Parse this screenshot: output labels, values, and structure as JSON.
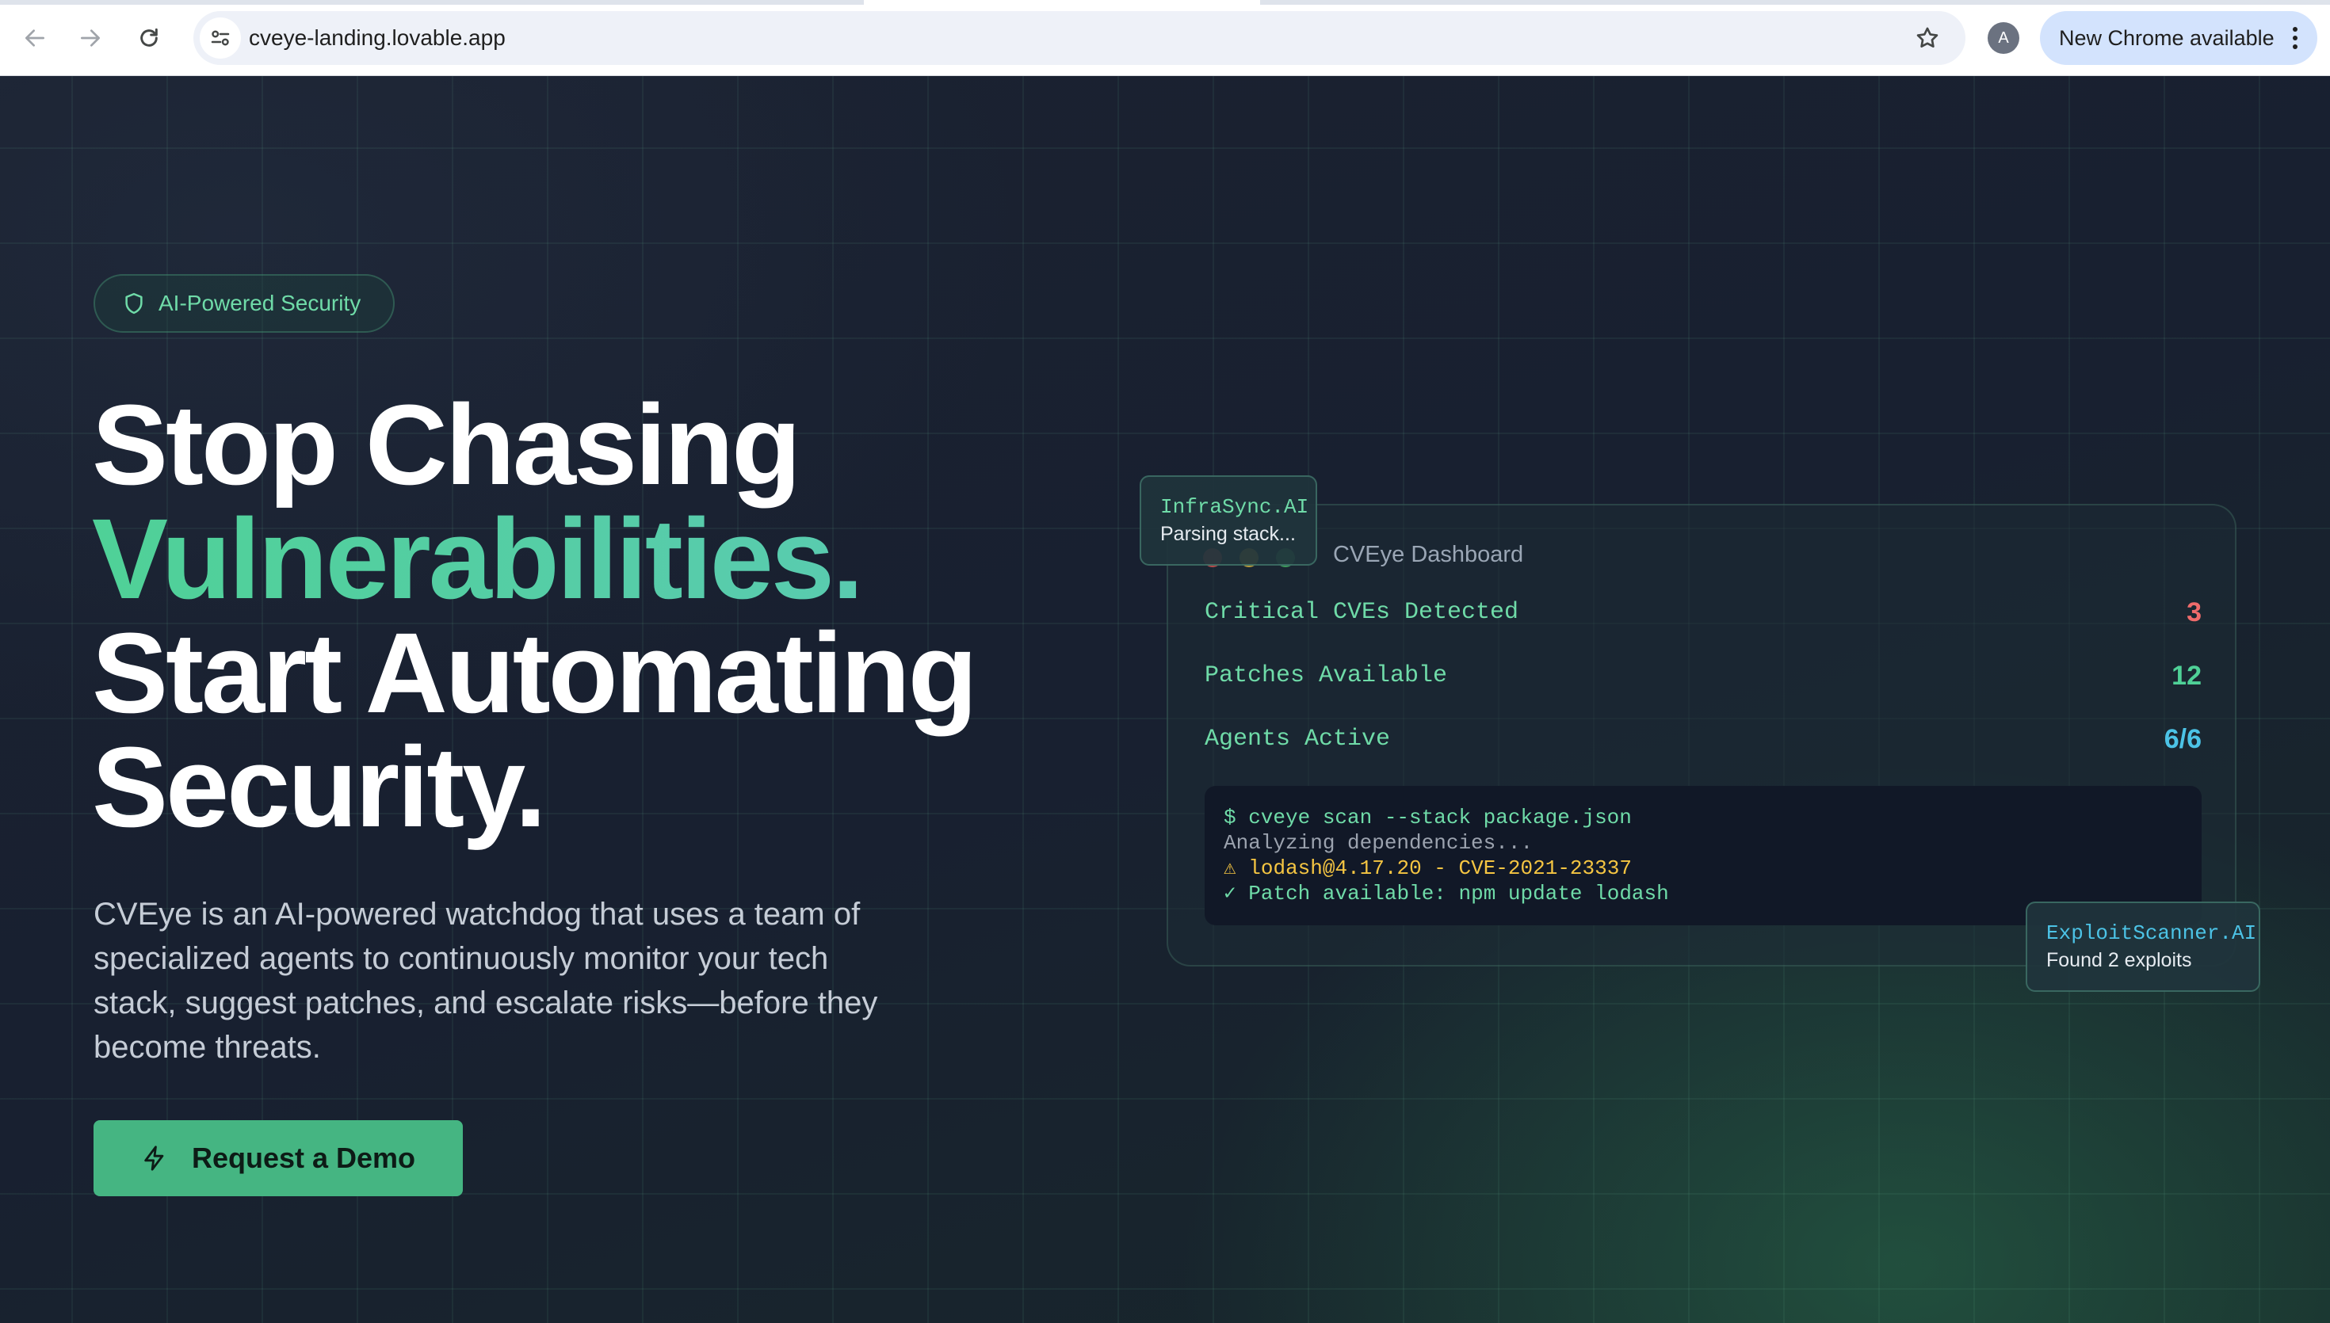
{
  "browser": {
    "url": "cveye-landing.lovable.app",
    "profile_initial": "A",
    "update_label": "New Chrome available",
    "icons": [
      "back-arrow-icon",
      "forward-arrow-icon",
      "reload-icon",
      "site-info-icon",
      "bookmark-star-icon",
      "kebab-menu-icon"
    ]
  },
  "hero": {
    "badge": "AI-Powered Security",
    "headline": {
      "line1": "Stop Chasing",
      "line2": "Vulnerabilities.",
      "line3": "Start Automating",
      "line4": "Security."
    },
    "description": "CVEye is an AI-powered watchdog that uses a team of specialized agents to continuously monitor your tech stack, suggest patches, and escalate risks—before they become threats.",
    "cta": "Request a Demo"
  },
  "dashboard": {
    "title": "CVEye Dashboard",
    "stats": [
      {
        "label": "Critical CVEs Detected",
        "value": "3",
        "color": "#ef6b6b"
      },
      {
        "label": "Patches Available",
        "value": "12",
        "color": "#4fd197"
      },
      {
        "label": "Agents Active",
        "value": "6/6",
        "color": "#4cc3e6"
      }
    ],
    "terminal": [
      {
        "text": "$ cveye scan --stack package.json",
        "color": "#6fdba8"
      },
      {
        "text": "Analyzing dependencies...",
        "color": "#9ca3af"
      },
      {
        "text": "⚠ lodash@4.17.20 - CVE-2021-23337",
        "color": "#f5c542"
      },
      {
        "text": "✓ Patch available: npm update lodash",
        "color": "#6fdba8"
      }
    ]
  },
  "agents": {
    "infra": {
      "name": "InfraSync.AI",
      "status": "Parsing stack..."
    },
    "exploit": {
      "name": "ExploitScanner.AI",
      "status": "Found 2 exploits"
    }
  },
  "colors": {
    "accent": "#45b582",
    "accent_text": "#6fdba8",
    "agent_name_infra": "#6fdba8",
    "agent_name_exploit": "#4cc3e6"
  }
}
